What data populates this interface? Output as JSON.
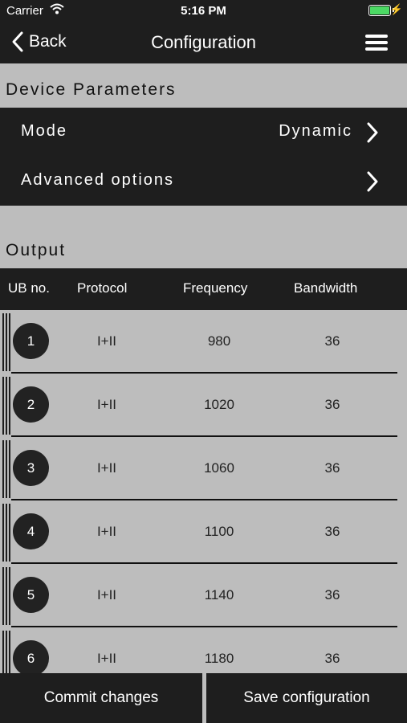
{
  "status": {
    "carrier": "Carrier",
    "time": "5:16 PM"
  },
  "nav": {
    "back_label": "Back",
    "title": "Configuration"
  },
  "device_params": {
    "title": "Device Parameters",
    "mode_label": "Mode",
    "mode_value": "Dynamic",
    "advanced_label": "Advanced options"
  },
  "output": {
    "title": "Output",
    "headers": {
      "ub": "UB no.",
      "protocol": "Protocol",
      "frequency": "Frequency",
      "bandwidth": "Bandwidth"
    },
    "rows": [
      {
        "ub": "1",
        "protocol": "I+II",
        "frequency": "980",
        "bandwidth": "36"
      },
      {
        "ub": "2",
        "protocol": "I+II",
        "frequency": "1020",
        "bandwidth": "36"
      },
      {
        "ub": "3",
        "protocol": "I+II",
        "frequency": "1060",
        "bandwidth": "36"
      },
      {
        "ub": "4",
        "protocol": "I+II",
        "frequency": "1100",
        "bandwidth": "36"
      },
      {
        "ub": "5",
        "protocol": "I+II",
        "frequency": "1140",
        "bandwidth": "36"
      },
      {
        "ub": "6",
        "protocol": "I+II",
        "frequency": "1180",
        "bandwidth": "36"
      }
    ]
  },
  "footer": {
    "commit_label": "Commit changes",
    "save_label": "Save configuration"
  },
  "colors": {
    "dark": "#1e1e1e",
    "background": "#bdbdbd",
    "battery": "#4cd964"
  },
  "icons": {
    "back": "chevron-left-icon",
    "menu": "hamburger-icon",
    "disclosure": "chevron-right-icon",
    "wifi": "wifi-icon",
    "battery": "battery-icon"
  }
}
